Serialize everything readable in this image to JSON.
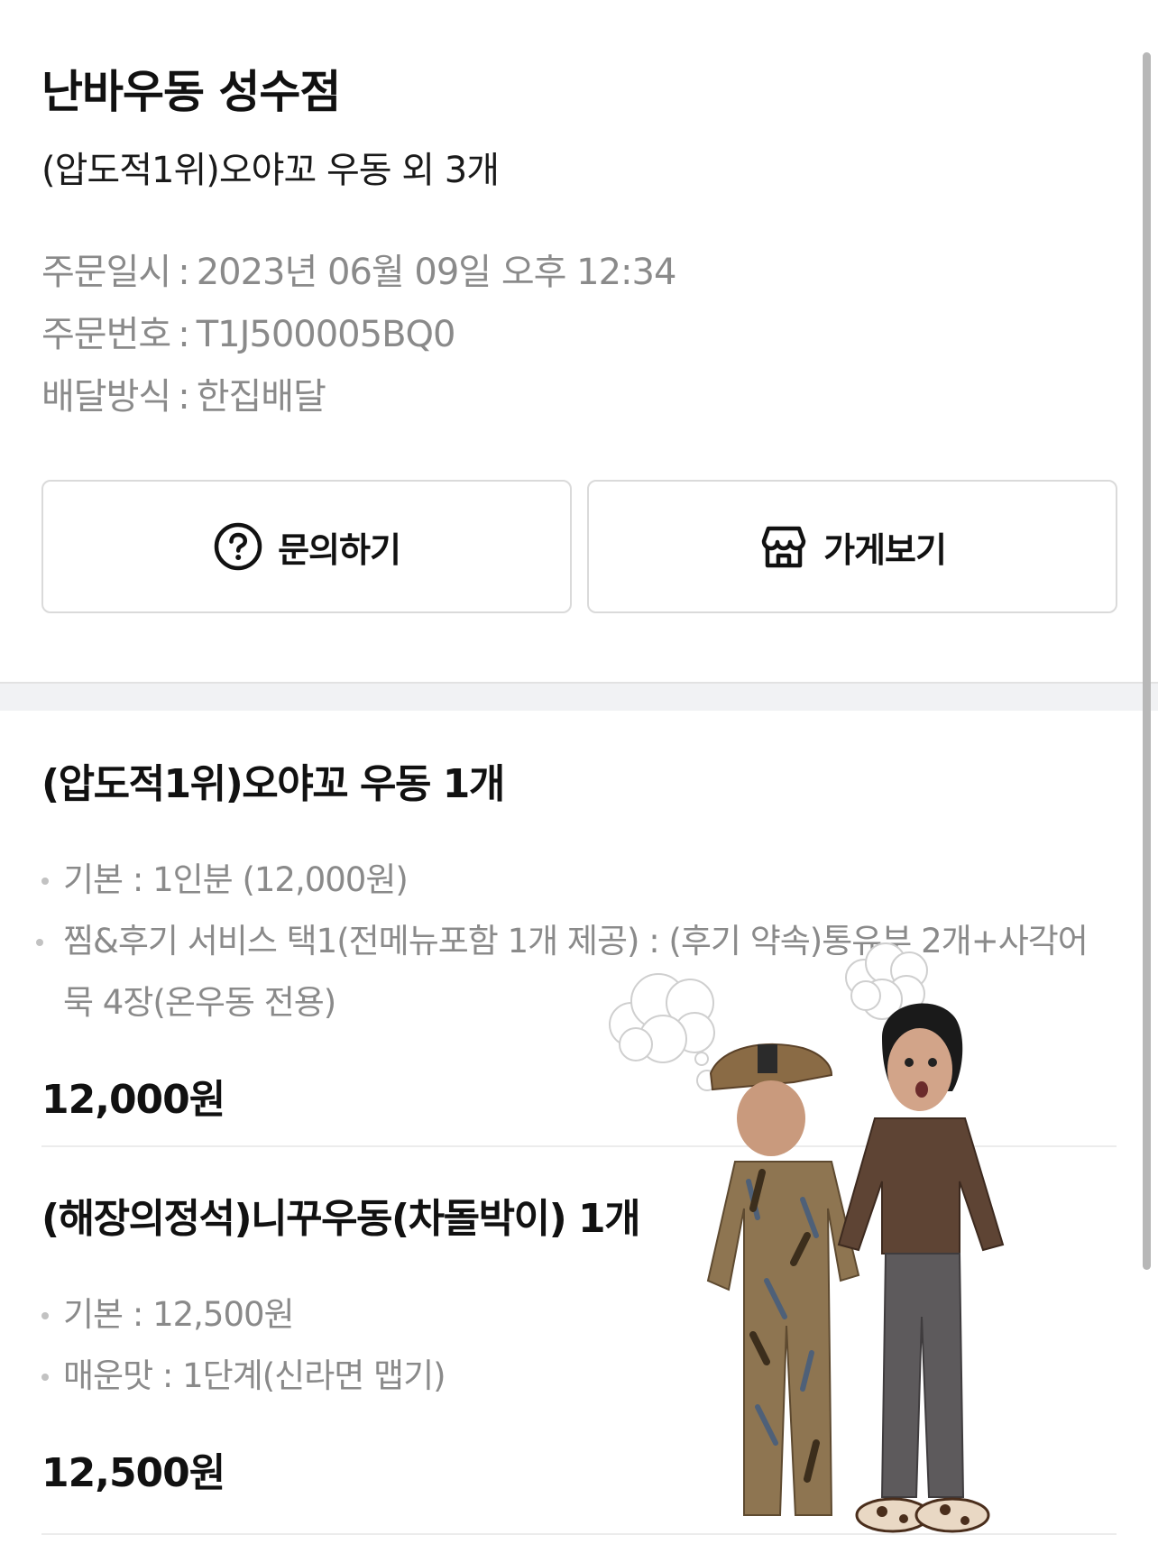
{
  "store": {
    "name": "난바우동 성수점",
    "order_summary": "(압도적1위)오야꼬 우동 외 3개"
  },
  "order_info": [
    {
      "label": "주문일시",
      "value": "2023년 06월 09일 오후 12:34"
    },
    {
      "label": "주문번호",
      "value": "T1J500005BQ0"
    },
    {
      "label": "배달방식",
      "value": "한집배달"
    }
  ],
  "buttons": {
    "inquiry": "문의하기",
    "store": "가게보기"
  },
  "items": [
    {
      "title": "(압도적1위)오야꼬 우동 1개",
      "options": [
        "기본 : 1인분 (12,000원)",
        "찜&후기 서비스 택1(전메뉴포함 1개 제공) : (후기 약속)통유부 2개+사각어묵 4장(온우동 전용)"
      ],
      "price": "12,000원"
    },
    {
      "title": "(해장의정석)니꾸우동(차돌박이) 1개",
      "options": [
        "기본 : 12,500원",
        "매운맛 : 1단계(신라면 맵기)"
      ],
      "price": "12,500원"
    }
  ],
  "icons": {
    "inquiry": "question-circle-icon",
    "store": "store-icon"
  }
}
